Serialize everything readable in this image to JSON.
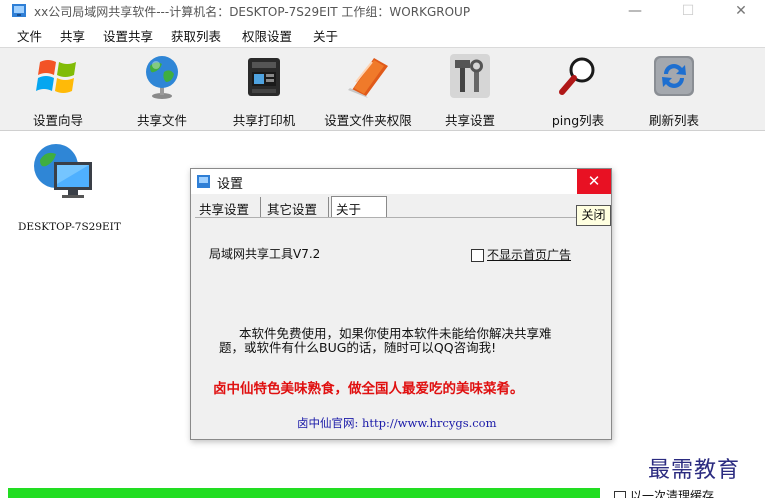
{
  "window": {
    "title": "xx公司局域网共享软件---计算机名：DESKTOP-7S29EIT  工作组：WORKGROUP",
    "min_glyph": "—",
    "max_glyph": "☐",
    "close_glyph": "✕"
  },
  "menu": [
    "文件",
    "共享",
    "设置共享",
    "获取列表",
    "权限设置",
    "关于"
  ],
  "toolbar": [
    {
      "label": "设置向导",
      "icon": "windows-logo-icon"
    },
    {
      "label": "共享文件",
      "icon": "globe-icon"
    },
    {
      "label": "共享打印机",
      "icon": "printer-icon"
    },
    {
      "label": "设置文件夹权限",
      "icon": "folder-book-icon"
    },
    {
      "label": "共享设置",
      "icon": "tools-icon"
    },
    {
      "label": "ping列表",
      "icon": "magnifier-icon"
    },
    {
      "label": "刷新列表",
      "icon": "refresh-icon"
    }
  ],
  "computer": {
    "name": "DESKTOP-7S29EIT"
  },
  "dialog": {
    "title": "设置",
    "close_glyph": "✕",
    "tabs": [
      "共享设置",
      "其它设置",
      "关于"
    ],
    "active_tab": "关于",
    "close_button": "关闭",
    "version": "局域网共享工具V7.2",
    "checkbox_label": "不显示首页广告",
    "checkbox_checked": false,
    "description_line1": "本软件免费使用，如果你使用本软件未能给你解决共享难",
    "description_line2": "题，或软件有什么BUG的话，随时可以QQ咨询我!",
    "ad_text": "卤中仙特色美味熟食，做全国人最爱吃的美味菜肴。",
    "site_text": "卤中仙官网: http://www.hrcygs.com"
  },
  "watermark": "最需教育",
  "status": {
    "progress": 1.0,
    "checkbox_label": "以一次清理缓存"
  },
  "colors": {
    "accent_red": "#e81123",
    "ad_red": "#e01010",
    "link_blue": "#1a1aa8",
    "progress_green": "#22dd22"
  }
}
